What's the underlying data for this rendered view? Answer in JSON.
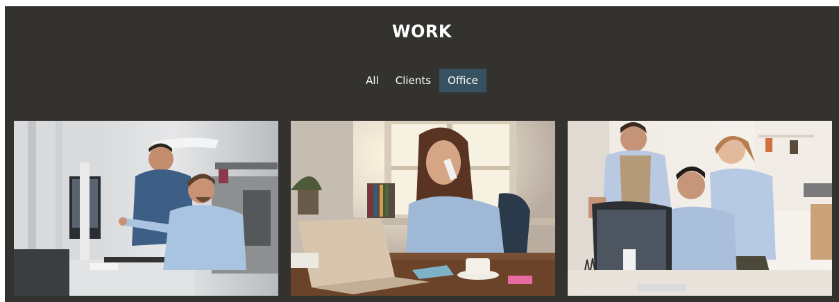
{
  "section": {
    "title": "WORK"
  },
  "filters": [
    {
      "label": "All",
      "active": false
    },
    {
      "label": "Clients",
      "active": false
    },
    {
      "label": "Office",
      "active": true
    }
  ],
  "colors": {
    "panel_bg": "#34322f",
    "active_filter_bg": "#365260",
    "text": "#ffffff"
  },
  "gallery": [
    {
      "subject": "two men at computer in office"
    },
    {
      "subject": "woman on phone with laptop"
    },
    {
      "subject": "three colleagues at desktop computer"
    }
  ]
}
